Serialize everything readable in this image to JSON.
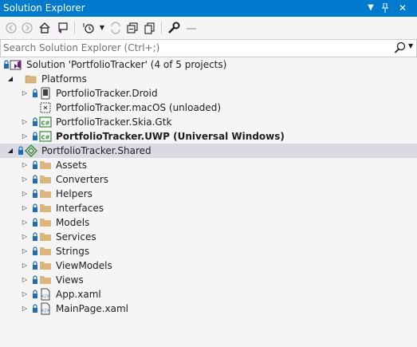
{
  "titlebar": {
    "title": "Solution Explorer",
    "buttons": [
      "dropdown-icon",
      "pin-icon",
      "close-icon"
    ]
  },
  "toolbar": {
    "icons": [
      "back-icon",
      "forward-icon",
      "home-icon",
      "switch-views-icon",
      "pending-changes-filter-icon",
      "sync-icon",
      "collapse-all-icon",
      "show-all-files-icon",
      "properties-icon",
      "preview-icon"
    ]
  },
  "search": {
    "placeholder": "Search Solution Explorer (Ctrl+;)"
  },
  "tree": {
    "solution": "Solution 'PortfolioTracker' (4 of 5 projects)",
    "platforms_folder": "Platforms",
    "projects": [
      {
        "label": "PortfolioTracker.Droid",
        "icon": "android-project-icon"
      },
      {
        "label": "PortfolioTracker.macOS (unloaded)",
        "icon": "unloaded-project-icon"
      },
      {
        "label": "PortfolioTracker.Skia.Gtk",
        "icon": "csharp-project-icon"
      },
      {
        "label": "PortfolioTracker.UWP (Universal Windows)",
        "icon": "csharp-project-icon",
        "startup": true
      }
    ],
    "shared_project": "PortfolioTracker.Shared",
    "shared_children": [
      {
        "label": "Assets",
        "icon": "folder-icon"
      },
      {
        "label": "Converters",
        "icon": "folder-icon"
      },
      {
        "label": "Helpers",
        "icon": "folder-icon"
      },
      {
        "label": "Interfaces",
        "icon": "folder-icon"
      },
      {
        "label": "Models",
        "icon": "folder-icon"
      },
      {
        "label": "Services",
        "icon": "folder-icon"
      },
      {
        "label": "Strings",
        "icon": "folder-icon"
      },
      {
        "label": "ViewModels",
        "icon": "folder-icon"
      },
      {
        "label": "Views",
        "icon": "folder-icon"
      },
      {
        "label": "App.xaml",
        "icon": "xaml-file-icon"
      },
      {
        "label": "MainPage.xaml",
        "icon": "xaml-file-icon"
      }
    ]
  },
  "colors": {
    "titlebar": "#007acc",
    "background": "#f5f5f5",
    "selected_row": "#dadae2",
    "folder": "#dcb67a",
    "lock": "#1e6bb8",
    "vs_purple": "#68217a",
    "shared_green": "#388a34"
  }
}
